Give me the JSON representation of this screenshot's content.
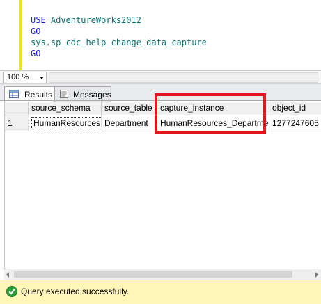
{
  "editor": {
    "lines": [
      {
        "kw": "USE",
        "rest": " AdventureWorks2012"
      },
      {
        "kw": "GO",
        "rest": ""
      },
      {
        "kw": "",
        "rest": "sys.sp_cdc_help_change_data_capture"
      },
      {
        "kw": "GO",
        "rest": ""
      }
    ]
  },
  "zoom": {
    "value": "100 %"
  },
  "tabs": [
    {
      "label": "Results",
      "icon": "grid-icon",
      "active": true
    },
    {
      "label": "Messages",
      "icon": "messages-icon",
      "active": false
    }
  ],
  "grid": {
    "columns": [
      "source_schema",
      "source_table",
      "capture_instance",
      "object_id"
    ],
    "rows": [
      {
        "num": "1",
        "cells": [
          "HumanResources",
          "Department",
          "HumanResources_Department",
          "1277247605"
        ]
      }
    ]
  },
  "status": {
    "text": "Query executed successfully.",
    "icon": "success-check-icon"
  },
  "colors": {
    "highlight": "#e0161f",
    "status_bg": "#fff6b8",
    "keyword": "#1d1dd0",
    "object": "#0b6f6f"
  }
}
